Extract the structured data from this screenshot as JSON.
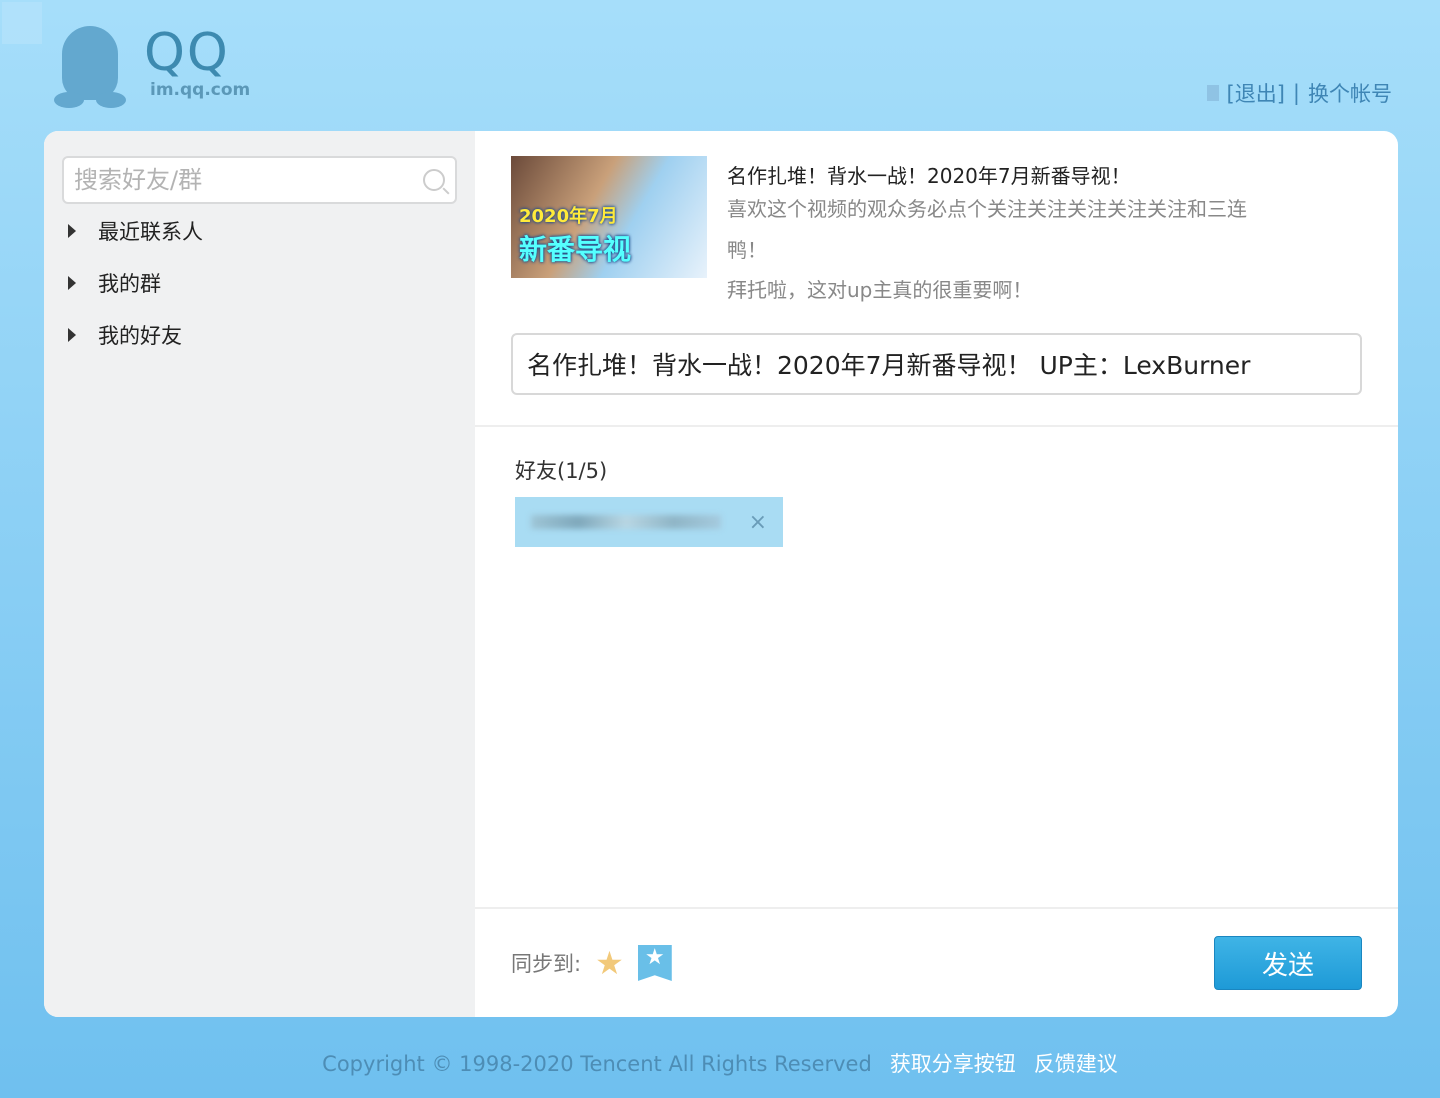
{
  "header": {
    "logo_title": "QQ",
    "logo_domain": "im.qq.com",
    "logout": "[退出]",
    "separator": "|",
    "switch_account": "换个帐号"
  },
  "sidebar": {
    "search_placeholder": "搜索好友/群",
    "groups": [
      {
        "label": "最近联系人"
      },
      {
        "label": "我的群"
      },
      {
        "label": "我的好友"
      }
    ]
  },
  "share": {
    "thumb_line1": "2020年7月",
    "thumb_line2": "新番导视",
    "title": "名作扎堆！背水一战！2020年7月新番导视！",
    "desc_line1": "喜欢这个视频的观众务必点个关注关注关注关注关注和三连",
    "desc_line2": "鸭！",
    "desc_line3": "拜托啦，这对up主真的很重要啊！",
    "message": "名作扎堆！背水一战！2020年7月新番导视！ UP主：LexBurner"
  },
  "friends": {
    "label": "好友(1/5)",
    "remove": "×"
  },
  "bottom": {
    "sync_label": "同步到:",
    "send": "发送"
  },
  "footer": {
    "copyright": "Copyright © 1998-2020 Tencent All Rights Reserved",
    "get_button": "获取分享按钮",
    "feedback": "反馈建议"
  }
}
